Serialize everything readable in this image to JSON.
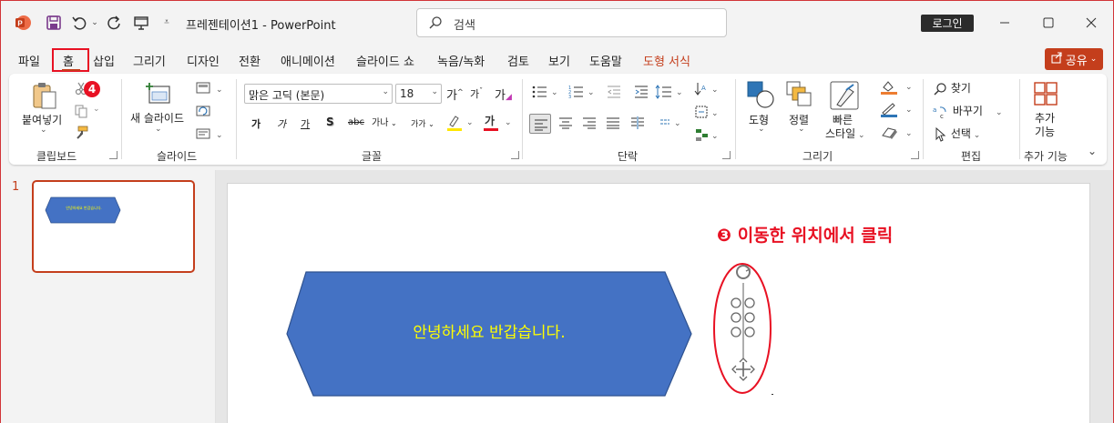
{
  "app": {
    "doc_title": "프레젠테이션1 - PowerPoint",
    "search_placeholder": "검색",
    "login_label": "로그인",
    "share_label": "공유",
    "accent": "#c43e1c"
  },
  "tabs": [
    {
      "label": "파일"
    },
    {
      "label": "홈"
    },
    {
      "label": "삽입"
    },
    {
      "label": "그리기"
    },
    {
      "label": "디자인"
    },
    {
      "label": "전환"
    },
    {
      "label": "애니메이션"
    },
    {
      "label": "슬라이드 쇼"
    },
    {
      "label": "녹음/녹화"
    },
    {
      "label": "검토"
    },
    {
      "label": "보기"
    },
    {
      "label": "도움말"
    },
    {
      "label": "도형 서식"
    }
  ],
  "ribbon": {
    "clipboard": {
      "paste": "붙여넣기",
      "label": "클립보드"
    },
    "slides": {
      "new_slide": "새 슬라이드",
      "label": "슬라이드"
    },
    "font": {
      "font_name": "맑은 고딕 (본문)",
      "font_size": "18",
      "label": "글꼴",
      "bold": "가",
      "italic": "가",
      "underline": "가",
      "shadow": "S",
      "strike": "abc",
      "spacing": "가나",
      "case": "가가"
    },
    "paragraph": {
      "label": "단락"
    },
    "drawing": {
      "shape": "도형",
      "arrange": "정렬",
      "quick_style_1": "빠른",
      "quick_style_2": "스타일",
      "label": "그리기"
    },
    "editing": {
      "find": "찾기",
      "replace": "바꾸기",
      "select": "선택",
      "label": "편집"
    },
    "addins": {
      "button_1": "추가",
      "button_2": "기능",
      "label": "추가 기능"
    }
  },
  "thumbnail": {
    "number": "1",
    "shape_text": "안녕하세요 반갑습니다."
  },
  "slide": {
    "shape_text": "안녕하세요 반갑습니다.",
    "shape_fill": "#4472c4",
    "shape_text_color": "#ffff00"
  },
  "annotations": {
    "step3": "❸ 이동한 위치에서 클릭",
    "step4_badge": "4",
    "color": "#e81123"
  }
}
